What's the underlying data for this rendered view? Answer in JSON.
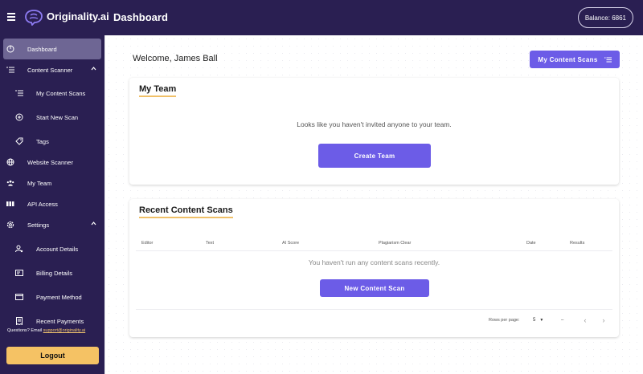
{
  "brand": {
    "name": "Originality.ai"
  },
  "header": {
    "title": "Dashboard",
    "balance": "Balance: 6861"
  },
  "sidebar": {
    "items": [
      {
        "label": "Dashboard"
      },
      {
        "label": "Content Scanner"
      },
      {
        "label": "My Content Scans"
      },
      {
        "label": "Start New Scan"
      },
      {
        "label": "Tags"
      },
      {
        "label": "Website Scanner"
      },
      {
        "label": "My Team"
      },
      {
        "label": "API Access"
      },
      {
        "label": "Settings"
      },
      {
        "label": "Account Details"
      },
      {
        "label": "Billing Details"
      },
      {
        "label": "Payment Method"
      },
      {
        "label": "Recent Payments"
      }
    ],
    "support_prefix": "Questions? Email ",
    "support_email": "support@originality.ai",
    "logout_label": "Logout"
  },
  "main": {
    "welcome": "Welcome, James Ball",
    "my_scans_button": "My Content Scans",
    "team": {
      "title": "My Team",
      "message": "Looks like you haven't invited anyone to your team.",
      "create_button": "Create Team"
    },
    "scans": {
      "title": "Recent Content Scans",
      "columns": [
        "Editor",
        "Text",
        "AI Score",
        "Plagiarism Clear",
        "Date",
        "Results"
      ],
      "empty_message": "You haven't run any content scans recently.",
      "new_scan_button": "New Content Scan",
      "rows_per_page_label": "Rows per page:",
      "rows_per_page_value": "5",
      "range": "–"
    }
  },
  "colors": {
    "sidebar": "#2a1f52",
    "accent": "#6c5ce7",
    "logout": "#f5c264"
  }
}
